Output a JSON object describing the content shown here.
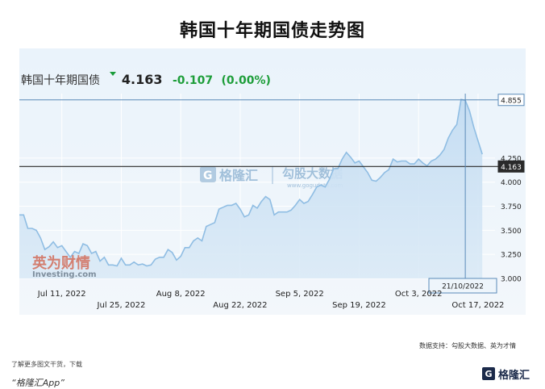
{
  "header": {
    "title": "韩国十年期国债走势图"
  },
  "quote": {
    "name": "韩国十年期国债",
    "price": "4.163",
    "change": "-0.107",
    "change_pct": "(0.00%)",
    "direction": "down",
    "color_change": "#1e9e3a"
  },
  "watermarks": {
    "gelonghui": "格隆汇",
    "gougu": "勾股大数据",
    "gougu_url": "www.gogudata.com",
    "yingwei": "英为财情",
    "investing": "Investing.com"
  },
  "chart_data": {
    "type": "area",
    "xlabel": "",
    "ylabel": "",
    "ylim": [
      3.0,
      4.92
    ],
    "yticks": [
      3.0,
      3.25,
      3.5,
      3.75,
      4.0,
      4.25
    ],
    "ytick_labels": [
      "3.000",
      "3.250",
      "3.500",
      "3.750",
      "4.000",
      "4.250"
    ],
    "x_tick_labels": [
      {
        "date": "2022-07-11",
        "label": "Jul 11, 2022",
        "row": 1
      },
      {
        "date": "2022-07-25",
        "label": "Jul 25, 2022",
        "row": 2
      },
      {
        "date": "2022-08-08",
        "label": "Aug 8, 2022",
        "row": 1
      },
      {
        "date": "2022-08-22",
        "label": "Aug 22, 2022",
        "row": 2
      },
      {
        "date": "2022-09-05",
        "label": "Sep 5, 2022",
        "row": 1
      },
      {
        "date": "2022-09-19",
        "label": "Sep 19, 2022",
        "row": 2
      },
      {
        "date": "2022-10-03",
        "label": "Oct 3, 2022",
        "row": 1
      },
      {
        "date": "2022-10-17",
        "label": "Oct 17, 2022",
        "row": 2
      }
    ],
    "grid": true,
    "series": [
      {
        "values": [
          [
            "2022-07-01",
            3.66
          ],
          [
            "2022-07-02",
            3.66
          ],
          [
            "2022-07-03",
            3.52
          ],
          [
            "2022-07-04",
            3.52
          ],
          [
            "2022-07-05",
            3.5
          ],
          [
            "2022-07-06",
            3.42
          ],
          [
            "2022-07-07",
            3.3
          ],
          [
            "2022-07-08",
            3.33
          ],
          [
            "2022-07-09",
            3.38
          ],
          [
            "2022-07-10",
            3.32
          ],
          [
            "2022-07-11",
            3.34
          ],
          [
            "2022-07-12",
            3.28
          ],
          [
            "2022-07-13",
            3.22
          ],
          [
            "2022-07-14",
            3.28
          ],
          [
            "2022-07-15",
            3.26
          ],
          [
            "2022-07-16",
            3.36
          ],
          [
            "2022-07-17",
            3.34
          ],
          [
            "2022-07-18",
            3.26
          ],
          [
            "2022-07-19",
            3.28
          ],
          [
            "2022-07-20",
            3.18
          ],
          [
            "2022-07-21",
            3.22
          ],
          [
            "2022-07-22",
            3.14
          ],
          [
            "2022-07-23",
            3.14
          ],
          [
            "2022-07-24",
            3.13
          ],
          [
            "2022-07-25",
            3.21
          ],
          [
            "2022-07-26",
            3.14
          ],
          [
            "2022-07-27",
            3.14
          ],
          [
            "2022-07-28",
            3.17
          ],
          [
            "2022-07-29",
            3.14
          ],
          [
            "2022-07-30",
            3.15
          ],
          [
            "2022-07-31",
            3.13
          ],
          [
            "2022-08-01",
            3.14
          ],
          [
            "2022-08-02",
            3.2
          ],
          [
            "2022-08-03",
            3.22
          ],
          [
            "2022-08-04",
            3.22
          ],
          [
            "2022-08-05",
            3.3
          ],
          [
            "2022-08-06",
            3.27
          ],
          [
            "2022-08-07",
            3.19
          ],
          [
            "2022-08-08",
            3.23
          ],
          [
            "2022-08-09",
            3.32
          ],
          [
            "2022-08-10",
            3.32
          ],
          [
            "2022-08-11",
            3.39
          ],
          [
            "2022-08-12",
            3.42
          ],
          [
            "2022-08-13",
            3.39
          ],
          [
            "2022-08-14",
            3.54
          ],
          [
            "2022-08-15",
            3.56
          ],
          [
            "2022-08-16",
            3.58
          ],
          [
            "2022-08-17",
            3.72
          ],
          [
            "2022-08-18",
            3.74
          ],
          [
            "2022-08-19",
            3.76
          ],
          [
            "2022-08-20",
            3.76
          ],
          [
            "2022-08-21",
            3.78
          ],
          [
            "2022-08-22",
            3.72
          ],
          [
            "2022-08-23",
            3.64
          ],
          [
            "2022-08-24",
            3.66
          ],
          [
            "2022-08-25",
            3.76
          ],
          [
            "2022-08-26",
            3.73
          ],
          [
            "2022-08-27",
            3.8
          ],
          [
            "2022-08-28",
            3.85
          ],
          [
            "2022-08-29",
            3.82
          ],
          [
            "2022-08-30",
            3.66
          ],
          [
            "2022-08-31",
            3.69
          ],
          [
            "2022-09-01",
            3.69
          ],
          [
            "2022-09-02",
            3.69
          ],
          [
            "2022-09-03",
            3.71
          ],
          [
            "2022-09-04",
            3.76
          ],
          [
            "2022-09-05",
            3.82
          ],
          [
            "2022-09-06",
            3.78
          ],
          [
            "2022-09-07",
            3.8
          ],
          [
            "2022-09-08",
            3.87
          ],
          [
            "2022-09-09",
            3.95
          ],
          [
            "2022-09-10",
            3.97
          ],
          [
            "2022-09-11",
            3.95
          ],
          [
            "2022-09-12",
            4.03
          ],
          [
            "2022-09-13",
            4.14
          ],
          [
            "2022-09-14",
            4.14
          ],
          [
            "2022-09-15",
            4.24
          ],
          [
            "2022-09-16",
            4.31
          ],
          [
            "2022-09-17",
            4.26
          ],
          [
            "2022-09-18",
            4.2
          ],
          [
            "2022-09-19",
            4.22
          ],
          [
            "2022-09-20",
            4.16
          ],
          [
            "2022-09-21",
            4.1
          ],
          [
            "2022-09-22",
            4.02
          ],
          [
            "2022-09-23",
            4.01
          ],
          [
            "2022-09-24",
            4.05
          ],
          [
            "2022-09-25",
            4.1
          ],
          [
            "2022-09-26",
            4.13
          ],
          [
            "2022-09-27",
            4.24
          ],
          [
            "2022-09-28",
            4.21
          ],
          [
            "2022-09-29",
            4.22
          ],
          [
            "2022-09-30",
            4.22
          ],
          [
            "2022-10-01",
            4.19
          ],
          [
            "2022-10-02",
            4.19
          ],
          [
            "2022-10-03",
            4.24
          ],
          [
            "2022-10-04",
            4.2
          ],
          [
            "2022-10-05",
            4.17
          ],
          [
            "2022-10-06",
            4.22
          ],
          [
            "2022-10-07",
            4.24
          ],
          [
            "2022-10-08",
            4.28
          ],
          [
            "2022-10-09",
            4.34
          ],
          [
            "2022-10-10",
            4.46
          ],
          [
            "2022-10-11",
            4.54
          ],
          [
            "2022-10-12",
            4.6
          ],
          [
            "2022-10-13",
            4.86
          ],
          [
            "2022-10-14",
            4.85
          ],
          [
            "2022-10-15",
            4.74
          ],
          [
            "2022-10-16",
            4.57
          ],
          [
            "2022-10-17",
            4.43
          ],
          [
            "2022-10-18",
            4.29
          ]
        ]
      }
    ],
    "reference_lines": [
      {
        "value": "4.855",
        "color": "#5a8ab8"
      },
      {
        "value": "4.163",
        "color": "#2a2a2a"
      }
    ],
    "crosshair_date_label": "21/10/2022"
  },
  "footer": {
    "note": "了解更多图文干货，下载",
    "app": "“格隆汇App”",
    "source": "数据支持：勾股大数据、英为才情",
    "logo_text": "格隆汇"
  }
}
